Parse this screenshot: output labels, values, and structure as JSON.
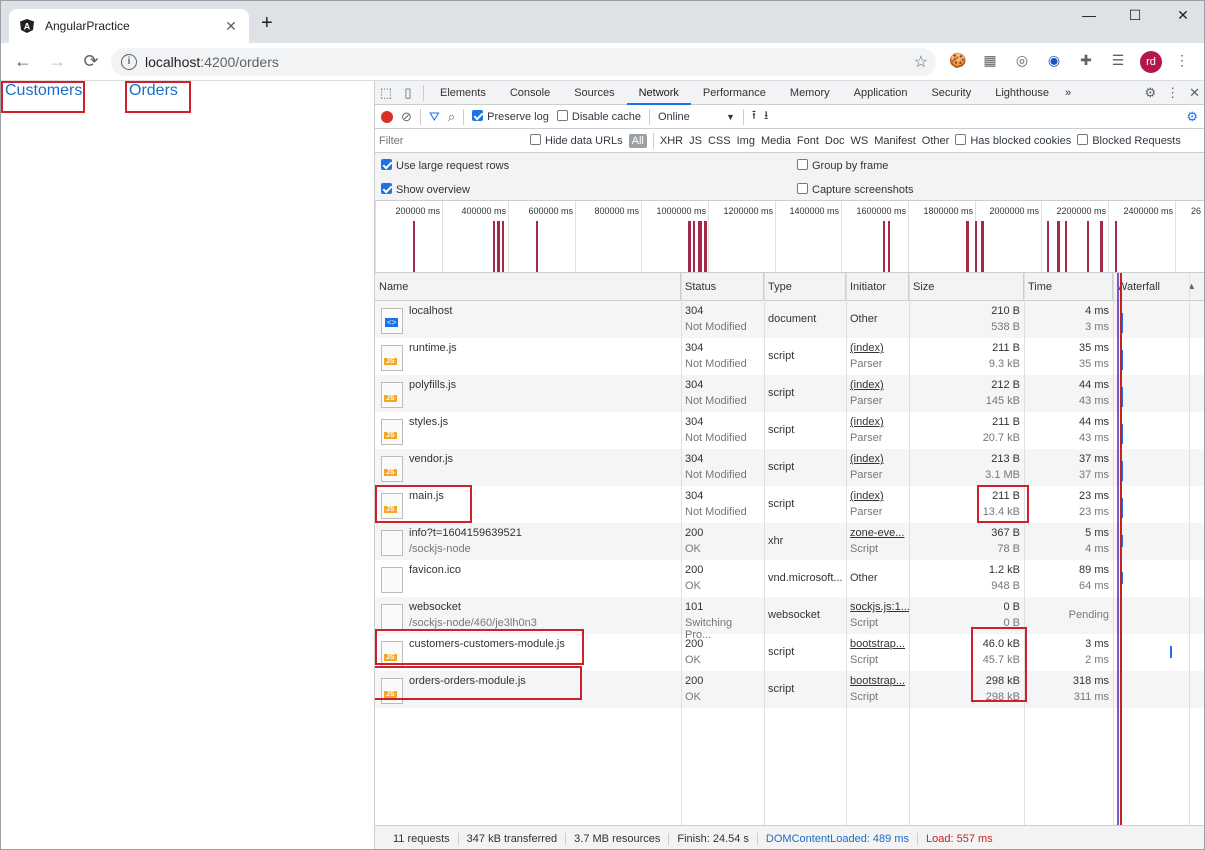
{
  "tab": {
    "title": "AngularPractice",
    "close": "✕"
  },
  "new_tab": "+",
  "window": {
    "minimize": "—",
    "maximize": "☐",
    "close": "✕"
  },
  "address": {
    "host": "localhost",
    "path": ":4200/orders"
  },
  "avatar": "rd",
  "page": {
    "links": [
      "Customers",
      "Orders"
    ]
  },
  "devtools": {
    "tabs": [
      "Elements",
      "Console",
      "Sources",
      "Network",
      "Performance",
      "Memory",
      "Application",
      "Security",
      "Lighthouse",
      "»"
    ],
    "active_tab": "Network",
    "toolbar": {
      "preserve_log": "Preserve log",
      "disable_cache": "Disable cache",
      "throttle": "Online"
    },
    "filter": {
      "placeholder": "Filter",
      "hide_data_urls": "Hide data URLs",
      "types": [
        "All",
        "XHR",
        "JS",
        "CSS",
        "Img",
        "Media",
        "Font",
        "Doc",
        "WS",
        "Manifest",
        "Other"
      ],
      "has_blocked_cookies": "Has blocked cookies",
      "blocked_requests": "Blocked Requests"
    },
    "options": {
      "large_rows": "Use large request rows",
      "show_overview": "Show overview",
      "group_by_frame": "Group by frame",
      "capture_screenshots": "Capture screenshots"
    },
    "overview_ticks": [
      "200000 ms",
      "400000 ms",
      "600000 ms",
      "800000 ms",
      "1000000 ms",
      "1200000 ms",
      "1400000 ms",
      "1600000 ms",
      "1800000 ms",
      "2000000 ms",
      "2200000 ms",
      "2400000 ms",
      "26"
    ],
    "columns": [
      "Name",
      "Status",
      "Type",
      "Initiator",
      "Size",
      "Time",
      "Waterfall"
    ],
    "rows": [
      {
        "name": "localhost",
        "sub": "",
        "status": "304",
        "status_text": "Not Modified",
        "type": "document",
        "init": "Other",
        "init_sub": "",
        "size": "210 B",
        "size2": "538 B",
        "time": "4 ms",
        "time2": "3 ms",
        "icon": "doc"
      },
      {
        "name": "runtime.js",
        "sub": "",
        "status": "304",
        "status_text": "Not Modified",
        "type": "script",
        "init": "(index)",
        "init_sub": "Parser",
        "size": "211 B",
        "size2": "9.3 kB",
        "time": "35 ms",
        "time2": "35 ms",
        "icon": "js"
      },
      {
        "name": "polyfills.js",
        "sub": "",
        "status": "304",
        "status_text": "Not Modified",
        "type": "script",
        "init": "(index)",
        "init_sub": "Parser",
        "size": "212 B",
        "size2": "145 kB",
        "time": "44 ms",
        "time2": "43 ms",
        "icon": "js"
      },
      {
        "name": "styles.js",
        "sub": "",
        "status": "304",
        "status_text": "Not Modified",
        "type": "script",
        "init": "(index)",
        "init_sub": "Parser",
        "size": "211 B",
        "size2": "20.7 kB",
        "time": "44 ms",
        "time2": "43 ms",
        "icon": "js"
      },
      {
        "name": "vendor.js",
        "sub": "",
        "status": "304",
        "status_text": "Not Modified",
        "type": "script",
        "init": "(index)",
        "init_sub": "Parser",
        "size": "213 B",
        "size2": "3.1 MB",
        "time": "37 ms",
        "time2": "37 ms",
        "icon": "js"
      },
      {
        "name": "main.js",
        "sub": "",
        "status": "304",
        "status_text": "Not Modified",
        "type": "script",
        "init": "(index)",
        "init_sub": "Parser",
        "size": "211 B",
        "size2": "13.4 kB",
        "time": "23 ms",
        "time2": "23 ms",
        "icon": "js"
      },
      {
        "name": "info?t=1604159639521",
        "sub": "/sockjs-node",
        "status": "200",
        "status_text": "OK",
        "type": "xhr",
        "init": "zone-eve...",
        "init_sub": "Script",
        "size": "367 B",
        "size2": "78 B",
        "time": "5 ms",
        "time2": "4 ms",
        "icon": "blank"
      },
      {
        "name": "favicon.ico",
        "sub": "",
        "status": "200",
        "status_text": "OK",
        "type": "vnd.microsoft...",
        "init": "Other",
        "init_sub": "",
        "size": "1.2 kB",
        "size2": "948 B",
        "time": "89 ms",
        "time2": "64 ms",
        "icon": "blank"
      },
      {
        "name": "websocket",
        "sub": "/sockjs-node/460/je3lh0n3",
        "status": "101",
        "status_text": "Switching Pro...",
        "type": "websocket",
        "init": "sockjs.js:1...",
        "init_sub": "Script",
        "size": "0 B",
        "size2": "0 B",
        "time": "Pending",
        "time2": "",
        "icon": "blank"
      },
      {
        "name": "customers-customers-module.js",
        "sub": "",
        "status": "200",
        "status_text": "OK",
        "type": "script",
        "init": "bootstrap...",
        "init_sub": "Script",
        "size": "46.0 kB",
        "size2": "45.7 kB",
        "time": "3 ms",
        "time2": "2 ms",
        "icon": "js"
      },
      {
        "name": "orders-orders-module.js",
        "sub": "",
        "status": "200",
        "status_text": "OK",
        "type": "script",
        "init": "bootstrap...",
        "init_sub": "Script",
        "size": "298 kB",
        "size2": "298 kB",
        "time": "318 ms",
        "time2": "311 ms",
        "icon": "js"
      }
    ],
    "status_bar": [
      "11 requests",
      "347 kB transferred",
      "3.7 MB resources",
      "Finish: 24.54 s",
      "DOMContentLoaded: 489 ms",
      "Load: 557 ms"
    ]
  }
}
